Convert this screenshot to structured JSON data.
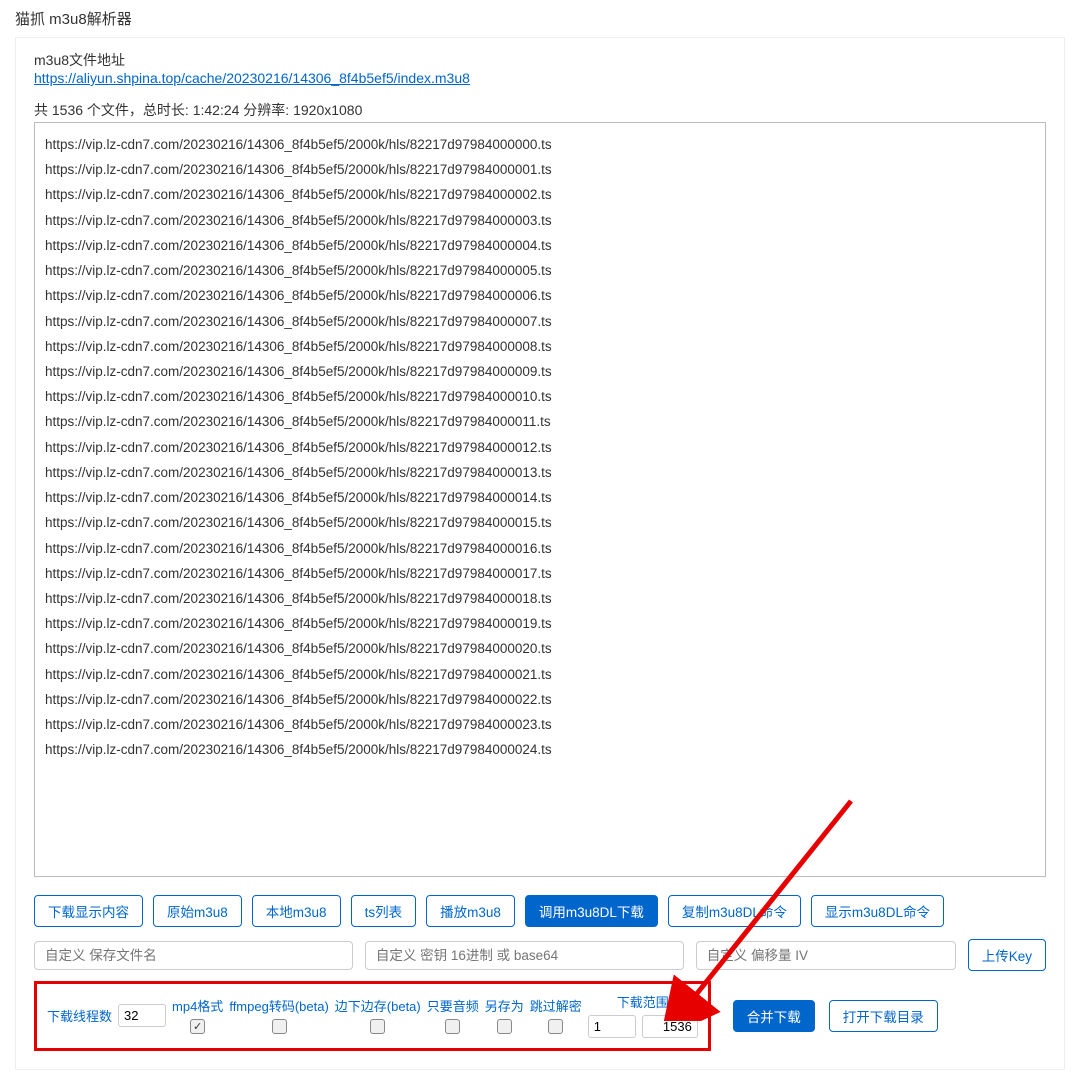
{
  "title": "猫抓 m3u8解析器",
  "file_addr_label": "m3u8文件地址",
  "file_addr_url": "https://aliyun.shpina.top/cache/20230216/14306_8f4b5ef5/index.m3u8",
  "summary": "共 1536 个文件，总时长: 1:42:24 分辨率: 1920x1080",
  "ts_files": [
    "https://vip.lz-cdn7.com/20230216/14306_8f4b5ef5/2000k/hls/82217d97984000000.ts",
    "https://vip.lz-cdn7.com/20230216/14306_8f4b5ef5/2000k/hls/82217d97984000001.ts",
    "https://vip.lz-cdn7.com/20230216/14306_8f4b5ef5/2000k/hls/82217d97984000002.ts",
    "https://vip.lz-cdn7.com/20230216/14306_8f4b5ef5/2000k/hls/82217d97984000003.ts",
    "https://vip.lz-cdn7.com/20230216/14306_8f4b5ef5/2000k/hls/82217d97984000004.ts",
    "https://vip.lz-cdn7.com/20230216/14306_8f4b5ef5/2000k/hls/82217d97984000005.ts",
    "https://vip.lz-cdn7.com/20230216/14306_8f4b5ef5/2000k/hls/82217d97984000006.ts",
    "https://vip.lz-cdn7.com/20230216/14306_8f4b5ef5/2000k/hls/82217d97984000007.ts",
    "https://vip.lz-cdn7.com/20230216/14306_8f4b5ef5/2000k/hls/82217d97984000008.ts",
    "https://vip.lz-cdn7.com/20230216/14306_8f4b5ef5/2000k/hls/82217d97984000009.ts",
    "https://vip.lz-cdn7.com/20230216/14306_8f4b5ef5/2000k/hls/82217d97984000010.ts",
    "https://vip.lz-cdn7.com/20230216/14306_8f4b5ef5/2000k/hls/82217d97984000011.ts",
    "https://vip.lz-cdn7.com/20230216/14306_8f4b5ef5/2000k/hls/82217d97984000012.ts",
    "https://vip.lz-cdn7.com/20230216/14306_8f4b5ef5/2000k/hls/82217d97984000013.ts",
    "https://vip.lz-cdn7.com/20230216/14306_8f4b5ef5/2000k/hls/82217d97984000014.ts",
    "https://vip.lz-cdn7.com/20230216/14306_8f4b5ef5/2000k/hls/82217d97984000015.ts",
    "https://vip.lz-cdn7.com/20230216/14306_8f4b5ef5/2000k/hls/82217d97984000016.ts",
    "https://vip.lz-cdn7.com/20230216/14306_8f4b5ef5/2000k/hls/82217d97984000017.ts",
    "https://vip.lz-cdn7.com/20230216/14306_8f4b5ef5/2000k/hls/82217d97984000018.ts",
    "https://vip.lz-cdn7.com/20230216/14306_8f4b5ef5/2000k/hls/82217d97984000019.ts",
    "https://vip.lz-cdn7.com/20230216/14306_8f4b5ef5/2000k/hls/82217d97984000020.ts",
    "https://vip.lz-cdn7.com/20230216/14306_8f4b5ef5/2000k/hls/82217d97984000021.ts",
    "https://vip.lz-cdn7.com/20230216/14306_8f4b5ef5/2000k/hls/82217d97984000022.ts",
    "https://vip.lz-cdn7.com/20230216/14306_8f4b5ef5/2000k/hls/82217d97984000023.ts",
    "https://vip.lz-cdn7.com/20230216/14306_8f4b5ef5/2000k/hls/82217d97984000024.ts"
  ],
  "buttons": {
    "download_display": "下载显示内容",
    "raw_m3u8": "原始m3u8",
    "local_m3u8": "本地m3u8",
    "ts_list": "ts列表",
    "play_m3u8": "播放m3u8",
    "call_m3u8dl": "调用m3u8DL下载",
    "copy_m3u8dl": "复制m3u8DL命令",
    "show_m3u8dl": "显示m3u8DL命令",
    "upload_key": "上传Key",
    "merge_download": "合并下载",
    "open_download_dir": "打开下载目录"
  },
  "placeholders": {
    "custom_filename": "自定义 保存文件名",
    "custom_key": "自定义 密钥 16进制 或 base64",
    "custom_iv": "自定义 偏移量 IV"
  },
  "options": {
    "thread_count_label": "下载线程数",
    "thread_count_value": "32",
    "mp4_format": "mp4格式",
    "ffmpeg_beta": "ffmpeg转码(beta)",
    "download_save_beta": "边下边存(beta)",
    "only_audio": "只要音频",
    "save_as": "另存为",
    "skip_decrypt": "跳过解密",
    "range_label": "下载范围",
    "range_start": "1",
    "range_end": "1536"
  }
}
